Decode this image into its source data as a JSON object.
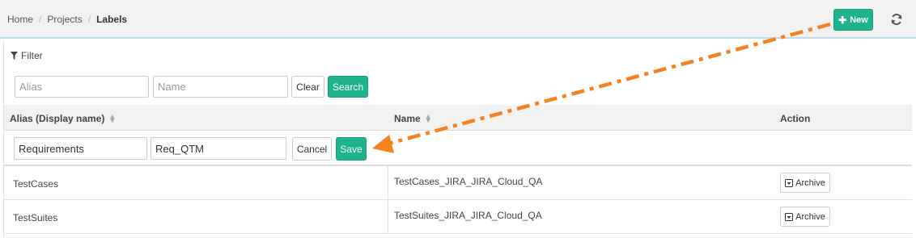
{
  "breadcrumb": {
    "items": [
      "Home",
      "Projects"
    ],
    "separator": "/",
    "current": "Labels"
  },
  "toolbar": {
    "new_label": "New",
    "new_icon": "plus-icon",
    "refresh_icon": "refresh-icon"
  },
  "filter": {
    "title": "Filter",
    "title_icon": "funnel-icon",
    "alias_placeholder": "Alias",
    "name_placeholder": "Name",
    "clear_label": "Clear",
    "search_label": "Search"
  },
  "table": {
    "headers": {
      "alias": "Alias (Display name)",
      "name": "Name",
      "action": "Action"
    },
    "edit_row": {
      "alias_value": "Requirements",
      "name_value": "Req_QTM",
      "cancel_label": "Cancel",
      "save_label": "Save"
    },
    "rows": [
      {
        "alias": "TestCases",
        "name": "TestCases_JIRA_JIRA_Cloud_QA",
        "action": "Archive"
      },
      {
        "alias": "TestSuites",
        "name": "TestSuites_JIRA_JIRA_Cloud_QA",
        "action": "Archive"
      }
    ]
  },
  "colors": {
    "accent": "#1fb38d",
    "annotation_arrow": "#f5821f",
    "header_bg": "#f2f2f2"
  }
}
